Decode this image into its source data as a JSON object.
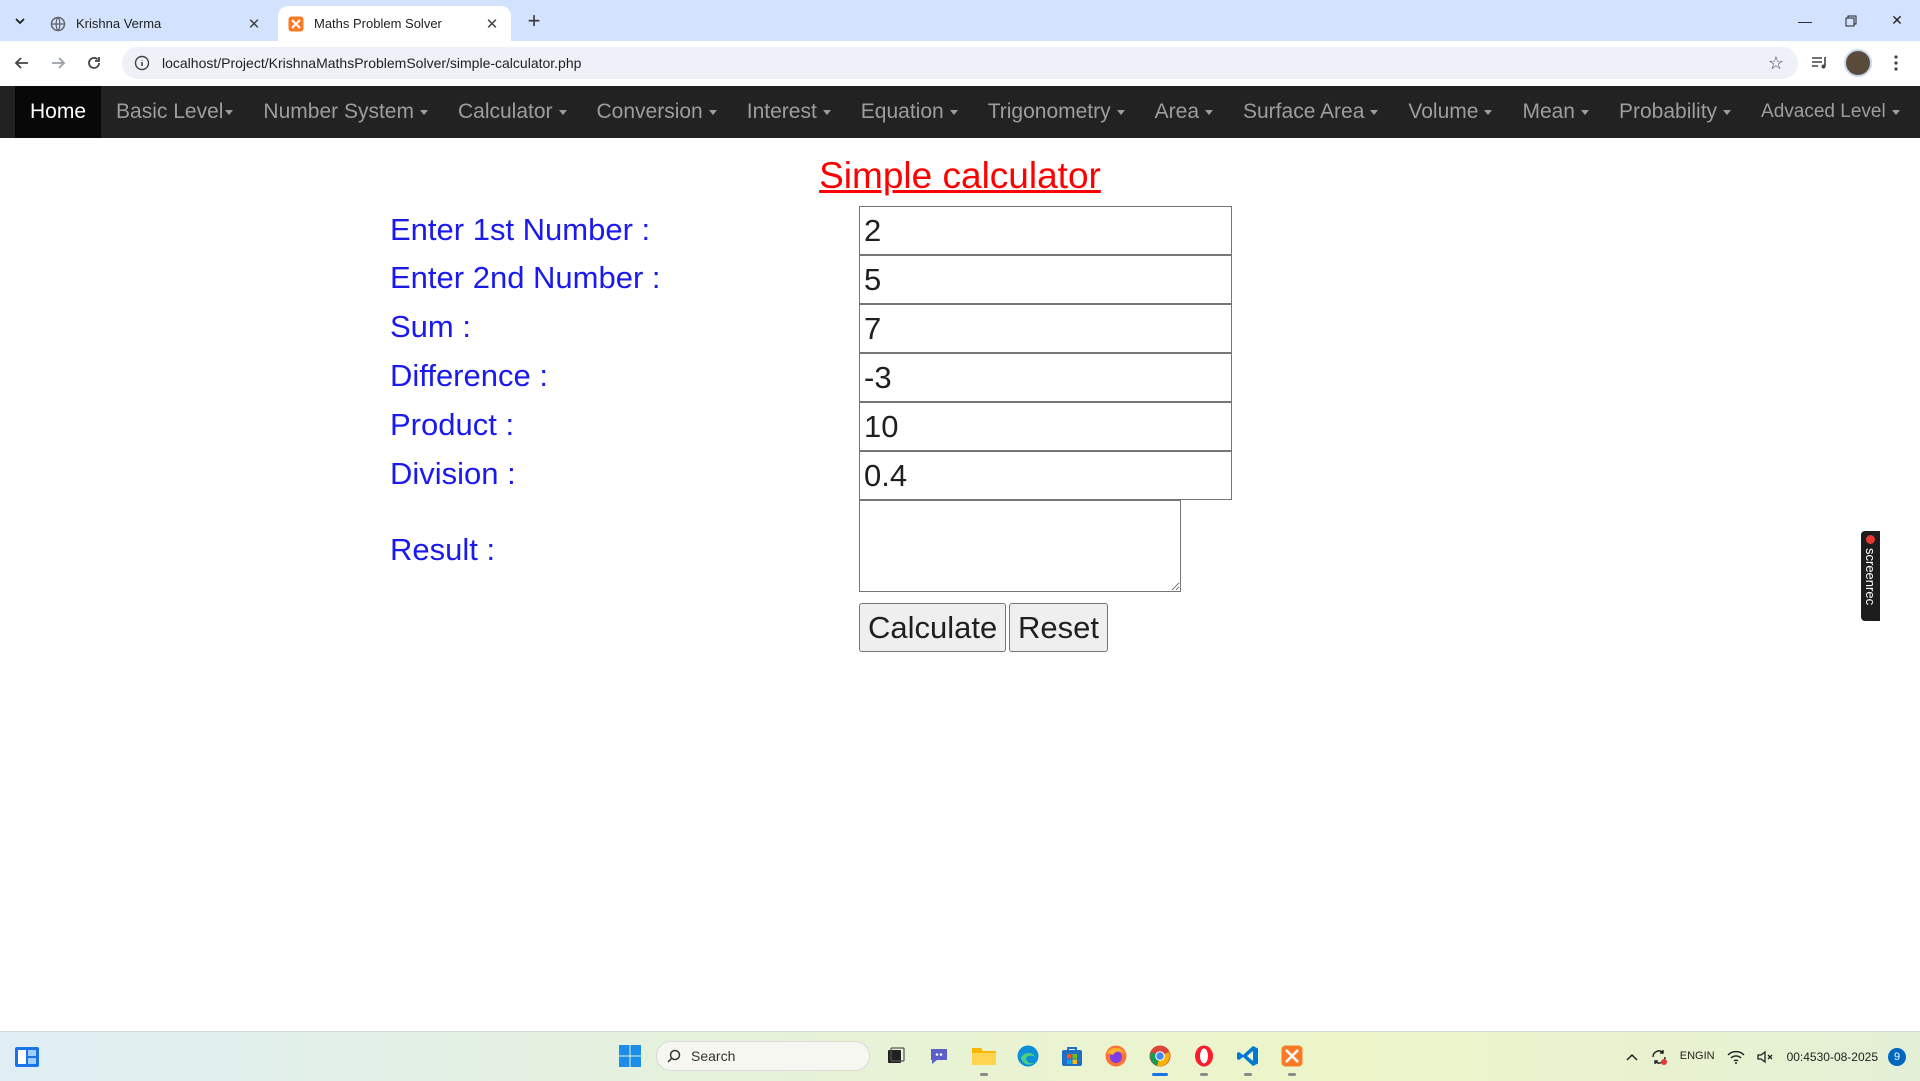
{
  "browser": {
    "tabs": [
      {
        "title": "Krishna Verma",
        "active": false
      },
      {
        "title": "Maths Problem Solver",
        "active": true
      }
    ],
    "url": "localhost/Project/KrishnaMathsProblemSolver/simple-calculator.php"
  },
  "navbar": {
    "items": [
      {
        "label": "Home"
      },
      {
        "label": "Basic Level"
      },
      {
        "label": "Number System"
      },
      {
        "label": "Calculator"
      },
      {
        "label": "Conversion"
      },
      {
        "label": "Interest"
      },
      {
        "label": "Equation"
      },
      {
        "label": "Trigonometry"
      },
      {
        "label": "Area"
      },
      {
        "label": "Surface Area"
      },
      {
        "label": "Volume"
      },
      {
        "label": "Mean"
      },
      {
        "label": "Probability"
      },
      {
        "label": "Advaced Level"
      }
    ]
  },
  "calculator": {
    "heading": "Simple calculator",
    "fields": [
      {
        "label": "Enter 1st Number :",
        "value": "2"
      },
      {
        "label": "Enter 2nd Number :",
        "value": "5"
      },
      {
        "label": "Sum :",
        "value": "7"
      },
      {
        "label": "Difference :",
        "value": "-3"
      },
      {
        "label": "Product :",
        "value": "10"
      },
      {
        "label": "Division :",
        "value": "0.4"
      }
    ],
    "result_label": "Result :",
    "result_value": "",
    "calculate_label": "Calculate",
    "reset_label": "Reset"
  },
  "screenrec": {
    "label": "screenrec"
  },
  "taskbar": {
    "search_placeholder": "Search",
    "language_line1": "ENG",
    "language_line2": "IN",
    "time": "00:45",
    "date": "30-08-2025",
    "notification_count": "9"
  },
  "colors": {
    "navbar_bg": "#222222",
    "nav_active_bg": "#080808",
    "heading": "#ff0000",
    "label": "#1a1aee"
  }
}
